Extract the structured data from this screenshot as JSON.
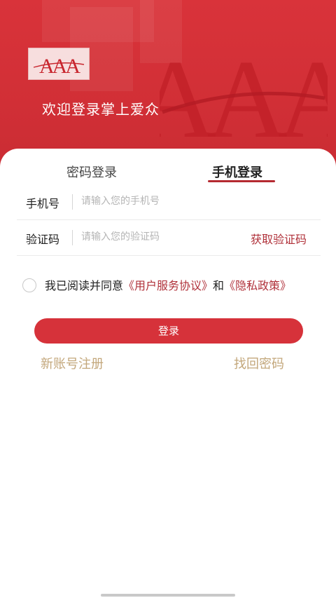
{
  "header": {
    "logo_text": "AAA",
    "watermark_text": "AAA",
    "welcome": "欢迎登录掌上爱众"
  },
  "tabs": [
    {
      "label": "密码登录",
      "active": false
    },
    {
      "label": "手机登录",
      "active": true
    }
  ],
  "form": {
    "phone_label": "手机号",
    "phone_placeholder": "请输入您的手机号",
    "code_label": "验证码",
    "code_placeholder": "请输入您的验证码",
    "get_code": "获取验证码"
  },
  "agreement": {
    "prefix": "我已阅读并同意",
    "user_agreement": "《用户服务协议》",
    "and": "和",
    "privacy_policy": "《隐私政策》",
    "checked": false
  },
  "login_button": "登录",
  "links": {
    "register": "新账号注册",
    "forgot": "找回密码"
  },
  "colors": {
    "brand_red": "#d6323a",
    "link_red": "#b0313a",
    "gold": "#c3a77b"
  }
}
